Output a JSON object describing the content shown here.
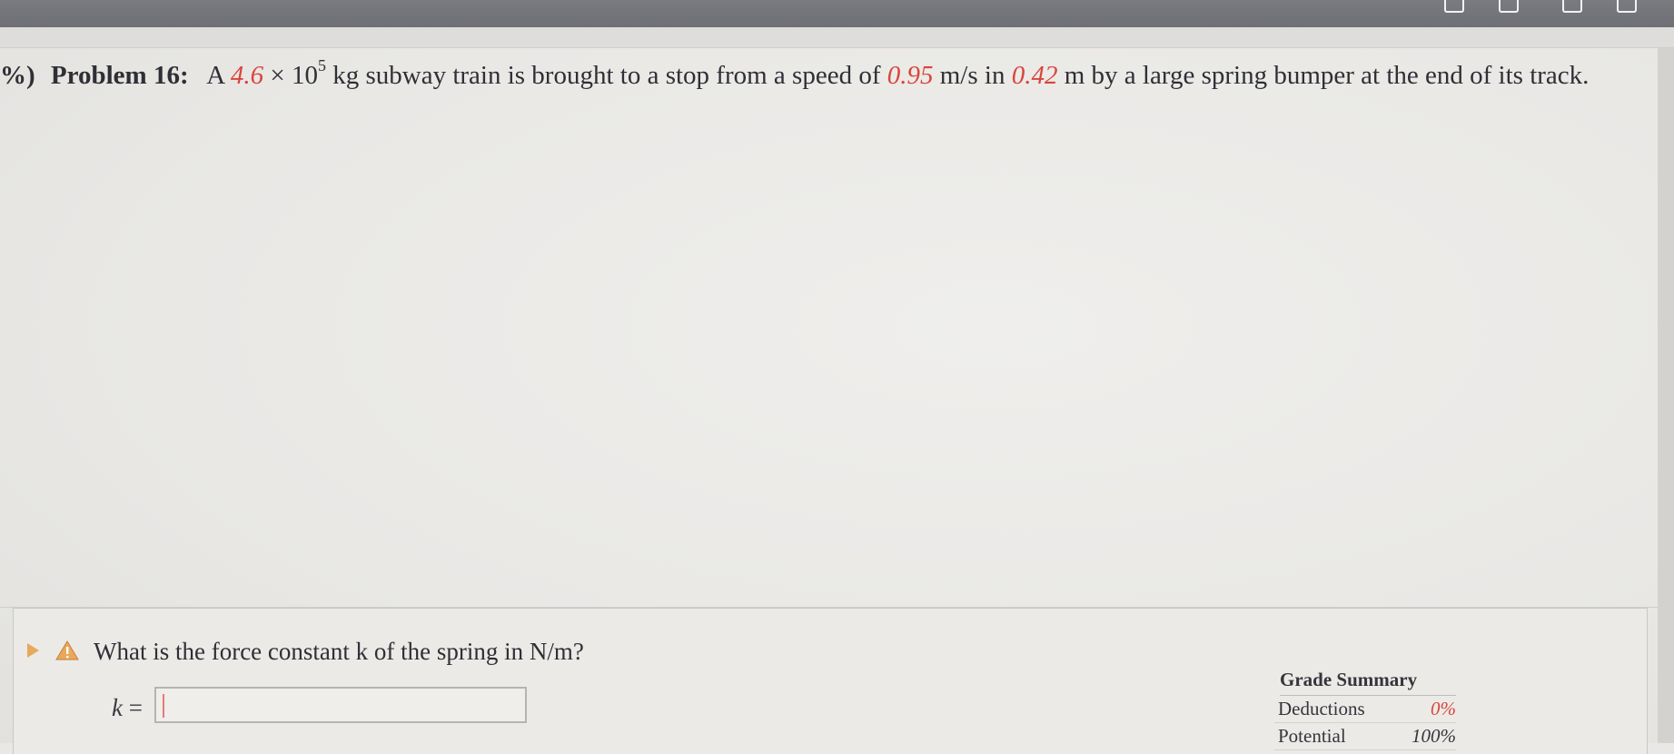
{
  "problem": {
    "percent_fragment": "%)",
    "label": "Problem 16:",
    "text_before_mass": "A",
    "mass_coefficient": "4.6",
    "times": "×",
    "mass_base": "10",
    "mass_exponent": "5",
    "text_after_mass": "kg subway train is brought to a stop from a speed of",
    "speed_value": "0.95",
    "speed_unit": "m/s in",
    "distance_value": "0.42",
    "text_end": "m by a large spring bumper at the end of its track."
  },
  "question": {
    "text": "What is the force constant k of the spring in N/m?",
    "answer_var": "k",
    "answer_equals": "=",
    "answer_value": ""
  },
  "grade_summary": {
    "title": "Grade Summary",
    "rows": [
      {
        "label": "Deductions",
        "value": "0%"
      },
      {
        "label": "Potential",
        "value": "100%"
      }
    ]
  },
  "colors": {
    "accent_red": "#d9453b",
    "warning_orange": "#e8a95c"
  },
  "icons": [
    "play-icon",
    "warning-icon",
    "window-icon"
  ]
}
